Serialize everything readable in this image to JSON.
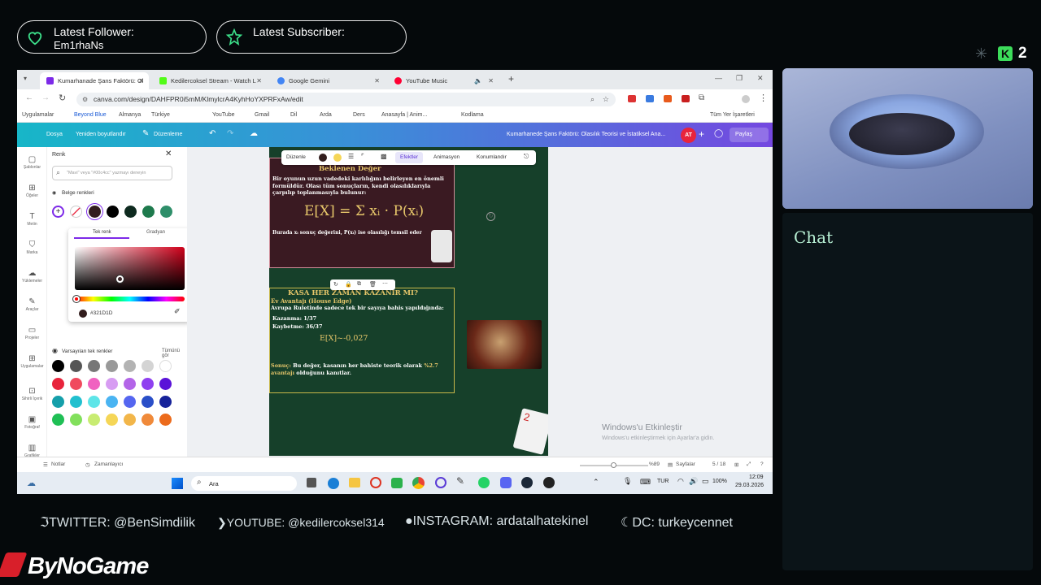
{
  "overlay": {
    "latest_follower_label": "Latest Follower:",
    "latest_follower_name": "Em1rhaNs",
    "latest_subscriber_label": "Latest Subscriber:",
    "counter": "2",
    "chat_title": "Chat",
    "socials": [
      "TWITTER: @BenSimdilik",
      "YOUTUBE: @kedilercoksel314",
      "INSTAGRAM: ardatalhatekinel",
      "DC: turkeycennet"
    ],
    "brand": "ByNoGame"
  },
  "browser": {
    "tabs": [
      {
        "label": "Kumarhanade Şans Faktörü: Ol",
        "color": "#7d2ae8"
      },
      {
        "label": "Kedilercoksel Stream - Watch L",
        "color": "#53fc18"
      },
      {
        "label": "Google Gemini",
        "color": "#4285f4"
      },
      {
        "label": "YouTube Music",
        "color": "#ff0033"
      }
    ],
    "url": "canva.com/design/DAHFPR0i5mM/KlmylcrA4KyhHoYXPRFxAw/edit",
    "bookmarks": [
      "Uygulamalar",
      "Beyond Blue",
      "Almanya",
      "Türkiye",
      "YouTube",
      "Gmail",
      "Dil",
      "Arda",
      "Ders",
      "Anasayfa | Anim...",
      "Kodlama",
      "Tüm Yer İşaretleri"
    ]
  },
  "canva": {
    "menu": [
      "Dosya",
      "Yeniden boyutlandır",
      "Düzenleme"
    ],
    "doc_title": "Kumarhanede Şans Faktörü: Olasılık Teorisi ve İstatiksel Ana...",
    "avatar": "AT",
    "share": "Paylaş",
    "sidebar": [
      "Şablonlar",
      "Öğeler",
      "Metin",
      "Marka",
      "Yüklemeler",
      "Araçlar",
      "Projeler",
      "Uygulamalar",
      "Sihirli İçerik",
      "Fotoğraf",
      "Grafikler"
    ],
    "color_panel": {
      "title": "Renk",
      "search_placeholder": "\"Mavi\" veya \"#00c4cc\" yazmayı deneyin",
      "doc_colors_label": "Belge renkleri",
      "tab_solid": "Tek renk",
      "tab_gradient": "Gradyan",
      "hex": "#321D1D",
      "defaults_label": "Varsayılan tek renkler",
      "see_all": "Tümünü gör",
      "doc_colors": [
        "#321d1d",
        "#000000",
        "#0e2a1f",
        "#16402a",
        "#1e7a4d",
        "#2f8f6a"
      ],
      "palette": [
        [
          "#000000",
          "#555555",
          "#777777",
          "#999999",
          "#b3b3b3",
          "#d4d4d4",
          "#ffffff"
        ],
        [
          "#e8243c",
          "#f04a5e",
          "#f062c0",
          "#d79cf2",
          "#b365e8",
          "#8f40f0",
          "#5a12d8"
        ],
        [
          "#159faa",
          "#21c0cf",
          "#5ee5e8",
          "#4ab4f2",
          "#5566f0",
          "#2a4fc8",
          "#16229a"
        ],
        [
          "#1fbf55",
          "#82e05c",
          "#c8ec72",
          "#f5d657",
          "#f2b64a",
          "#f08a3a",
          "#ec6b1c"
        ]
      ]
    },
    "float_toolbar": [
      "Düzenle",
      "Efektler",
      "Animasyon",
      "Konumlandır"
    ],
    "slide": {
      "card1_title": "Beklenen Değer",
      "card1_text": "Bir oyunun uzun vadedeki karlılığını belirleyen en önemli formüldür. Olası tüm sonuçların, kendi olasılıklarıyla çarpılıp toplanmasıyla bulunur:",
      "formula": "E[X] = Σ xᵢ · P(xᵢ)",
      "card1_note": "Burada xᵢ sonuç değerini, P(xᵢ) ise olasılığı temsil eder",
      "card2_title": "KASA HER ZAMAN KAZANIR MI?",
      "card2_sub": "Ev Avantajı (House Edge)",
      "card2_intro": "Avrupa Ruletinde sadece tek bir sayıya bahis yapıldığında:",
      "win": "Kazanma: 1/37",
      "lose": "Kaybetme: 36/37",
      "ex": "E[X]~-0,027",
      "result_prefix": "Sonuç:",
      "result_body": "Bu değer, kasanın her bahiste teorik olarak",
      "result_pct": "%2.7 avantajı",
      "result_end": "olduğunu kanıtlar."
    },
    "watermark_title": "Windows'u Etkinleştir",
    "watermark_sub": "Windows'u etkinleştirmek için Ayarlar'a gidin.",
    "status": {
      "notes": "Notlar",
      "timer": "Zamanlayıcı",
      "zoom": "%89",
      "pages": "Sayfalar",
      "page_count": "5 / 18"
    }
  },
  "taskbar": {
    "search": "Ara",
    "lang": "TUR",
    "battery": "100%",
    "time": "12:09",
    "date": "29.03.2026"
  }
}
